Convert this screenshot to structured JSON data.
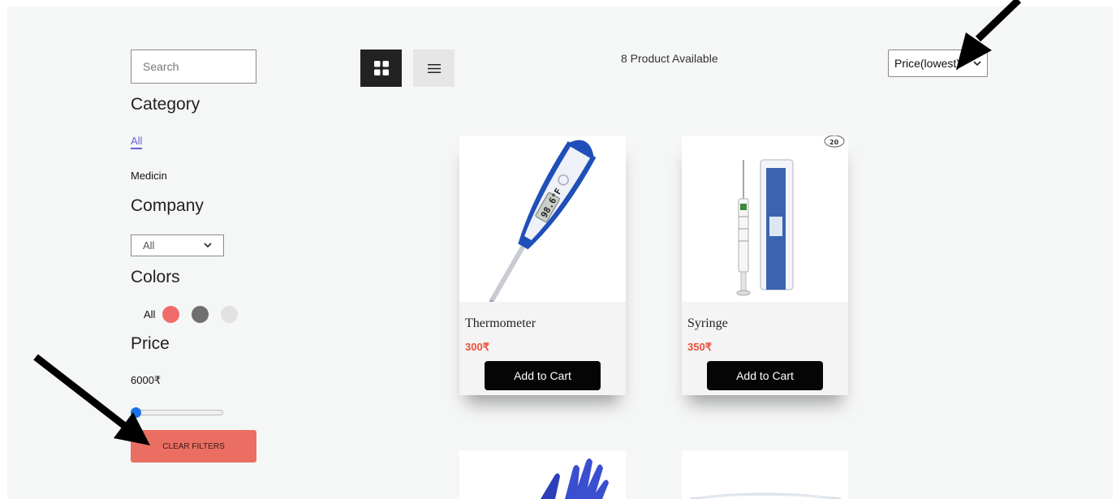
{
  "sidebar": {
    "search": {
      "placeholder": "Search"
    },
    "category": {
      "heading": "Category",
      "items": [
        {
          "label": "All",
          "active": true
        },
        {
          "label": "Medicin",
          "active": false
        }
      ]
    },
    "company": {
      "heading": "Company",
      "selected": "All"
    },
    "colors": {
      "heading": "Colors",
      "all_label": "All",
      "swatches": [
        {
          "color": "#f26b6b"
        },
        {
          "color": "#707070"
        },
        {
          "color": "#e2e2e2"
        }
      ]
    },
    "price": {
      "heading": "Price",
      "value": "6000₹",
      "slider_fraction": 0
    },
    "clear_label": "CLEAR FILTERS"
  },
  "toolbar": {
    "grid_icon": "grid-view-icon",
    "list_icon": "list-view-icon",
    "product_count": "8 Product Available",
    "sort_selected": "Price(lowest)"
  },
  "products": [
    {
      "name": "Thermometer",
      "price": "300₹",
      "button": "Add to Cart",
      "image_icon": "thermometer-image",
      "thermometer_reading": "98.6°F"
    },
    {
      "name": "Syringe",
      "price": "350₹",
      "button": "Add to Cart",
      "image_icon": "syringe-image",
      "badge": "20"
    }
  ],
  "partial_products": [
    {
      "image_icon": "gloves-image"
    },
    {
      "image_icon": "mask-image"
    }
  ],
  "colors": {
    "accent": "#6b5fd6",
    "clear_button": "#ea6f62",
    "price": "#ea4e3d",
    "cart_button": "#050505"
  }
}
